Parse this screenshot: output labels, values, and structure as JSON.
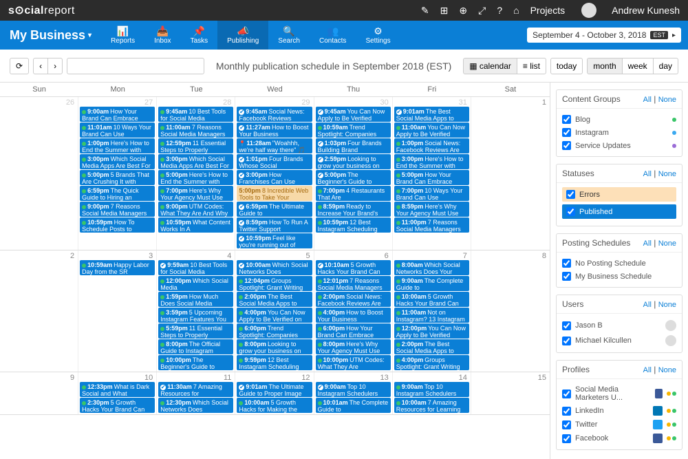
{
  "topbar": {
    "logo_prefix": "s",
    "logo_emoji_label": "cial",
    "logo_suffix": "report",
    "projects_label": "Projects",
    "username": "Andrew Kunesh"
  },
  "bluebar": {
    "business_name": "My Business",
    "nav": [
      {
        "icon": "📊",
        "label": "Reports"
      },
      {
        "icon": "📥",
        "label": "Inbox"
      },
      {
        "icon": "📌",
        "label": "Tasks"
      },
      {
        "icon": "📣",
        "label": "Publishing",
        "active": true
      },
      {
        "icon": "🔍",
        "label": "Search"
      },
      {
        "icon": "👥",
        "label": "Contacts"
      },
      {
        "icon": "⚙",
        "label": "Settings"
      }
    ],
    "date_range": "September 4 - October 3, 2018",
    "tz": "EST"
  },
  "toolbar": {
    "title": "Monthly publication schedule in September 2018 (EST)",
    "view_calendar": "calendar",
    "view_list": "list",
    "today": "today",
    "month": "month",
    "week": "week",
    "day": "day"
  },
  "dow": [
    "Sun",
    "Mon",
    "Tue",
    "Wed",
    "Thu",
    "Fri",
    "Sat"
  ],
  "weeks": [
    {
      "days": [
        {
          "num": "26",
          "other": true,
          "events": []
        },
        {
          "num": "27",
          "other": true,
          "events": [
            {
              "icon": "dot",
              "time": "9:00am",
              "title": "How Your Brand Can Embrace"
            },
            {
              "icon": "dot",
              "time": "11:01am",
              "title": "10 Ways Your Brand Can Use"
            },
            {
              "icon": "dot",
              "time": "1:00pm",
              "title": "Here's How to End the Summer with"
            },
            {
              "icon": "dot",
              "time": "3:00pm",
              "title": "Which Social Media Apps Are Best For"
            },
            {
              "icon": "dot",
              "time": "5:00pm",
              "title": "5 Brands That Are Crushing It with"
            },
            {
              "icon": "dot",
              "time": "6:59pm",
              "title": "The Quick Guide to Hiring an"
            },
            {
              "icon": "dot",
              "time": "9:00pm",
              "title": "7 Reasons Social Media Managers"
            },
            {
              "icon": "dot",
              "time": "10:59pm",
              "title": "How To Schedule Posts to"
            }
          ]
        },
        {
          "num": "28",
          "other": true,
          "events": [
            {
              "icon": "dot",
              "time": "9:45am",
              "title": "10 Best Tools for Social Media"
            },
            {
              "icon": "dot",
              "time": "11:00am",
              "title": "7 Reasons Social Media Managers"
            },
            {
              "icon": "dot",
              "time": "12:59pm",
              "title": "11 Essential Steps to Properly"
            },
            {
              "icon": "dot",
              "time": "3:00pm",
              "title": "Which Social Media Apps Are Best For"
            },
            {
              "icon": "dot",
              "time": "5:00pm",
              "title": "Here's How to End the Summer with"
            },
            {
              "icon": "dot",
              "time": "7:00pm",
              "title": "Here's Why Your Agency Must Use"
            },
            {
              "icon": "dot",
              "time": "9:00pm",
              "title": "UTM Codes: What They Are And Why"
            },
            {
              "icon": "dot",
              "time": "10:59pm",
              "title": "What Content Works In A"
            }
          ]
        },
        {
          "num": "29",
          "other": true,
          "events": [
            {
              "icon": "check",
              "time": "9:45am",
              "title": "Social News: Facebook Reviews"
            },
            {
              "icon": "check",
              "time": "11:27am",
              "title": "How to Boost Your Business"
            },
            {
              "icon": "loc",
              "time": "11:28am",
              "title": "\"Woahhh, we're half way there\" 🎵"
            },
            {
              "icon": "check",
              "time": "1:01pm",
              "title": "Four Brands Whose Social"
            },
            {
              "icon": "check",
              "time": "3:00pm",
              "title": "How Franchises Can Use"
            },
            {
              "icon": "",
              "time": "5:00pm",
              "title": "8 Incredible Web Tools to Take Your",
              "cls": "orange"
            },
            {
              "icon": "check",
              "time": "6:59pm",
              "title": "The Ultimate Guide to"
            },
            {
              "icon": "check",
              "time": "8:59pm",
              "title": "How To Run A Twitter Support"
            },
            {
              "icon": "check",
              "time": "10:59pm",
              "title": "Feel like you're running out of"
            }
          ]
        },
        {
          "num": "30",
          "other": true,
          "events": [
            {
              "icon": "check",
              "time": "9:45am",
              "title": "You Can Now Apply to Be Verified"
            },
            {
              "icon": "dot",
              "time": "10:59am",
              "title": "Trend Spotlight: Companies"
            },
            {
              "icon": "check",
              "time": "1:03pm",
              "title": "Four Brands Building Brand"
            },
            {
              "icon": "check",
              "time": "2:59pm",
              "title": "Looking to grow your business on"
            },
            {
              "icon": "check",
              "time": "5:00pm",
              "title": "The Beginner's Guide to"
            },
            {
              "icon": "dot",
              "time": "7:00pm",
              "title": "4 Restaurants That Are"
            },
            {
              "icon": "dot",
              "time": "8:59pm",
              "title": "Ready to Increase Your Brand's"
            },
            {
              "icon": "dot",
              "time": "10:59pm",
              "title": "12 Best Instagram Scheduling"
            }
          ]
        },
        {
          "num": "31",
          "other": true,
          "events": [
            {
              "icon": "check",
              "time": "9:01am",
              "title": "The Best Social Media Apps to"
            },
            {
              "icon": "dot",
              "time": "11:00am",
              "title": "You Can Now Apply to Be Verified"
            },
            {
              "icon": "dot",
              "time": "1:00pm",
              "title": "Social News: Facebook Reviews Are"
            },
            {
              "icon": "dot",
              "time": "3:00pm",
              "title": "Here's How to End the Summer with"
            },
            {
              "icon": "dot",
              "time": "5:00pm",
              "title": "How Your Brand Can Embrace"
            },
            {
              "icon": "dot",
              "time": "7:00pm",
              "title": "10 Ways Your Brand Can Use"
            },
            {
              "icon": "dot",
              "time": "8:59pm",
              "title": "Here's Why Your Agency Must Use"
            },
            {
              "icon": "dot",
              "time": "11:00pm",
              "title": "7 Reasons Social Media Managers"
            }
          ]
        },
        {
          "num": "1",
          "events": []
        }
      ]
    },
    {
      "days": [
        {
          "num": "2",
          "events": []
        },
        {
          "num": "3",
          "events": [
            {
              "icon": "dot",
              "time": "10:59am",
              "title": "Happy Labor Day from the SR"
            }
          ]
        },
        {
          "num": "4",
          "events": [
            {
              "icon": "check",
              "time": "9:59am",
              "title": "10 Best Tools for Social Media"
            },
            {
              "icon": "dot",
              "time": "12:00pm",
              "title": "Which Social Media"
            },
            {
              "icon": "dot",
              "time": "1:59pm",
              "title": "How Much Does Social Media"
            },
            {
              "icon": "dot",
              "time": "3:59pm",
              "title": "5 Upcoming Instagram Features You"
            },
            {
              "icon": "dot",
              "time": "5:59pm",
              "title": "11 Essential Steps to Properly"
            },
            {
              "icon": "dot",
              "time": "8:00pm",
              "title": "The Official Guide to Instagram"
            },
            {
              "icon": "dot",
              "time": "10:00pm",
              "title": "The Beginner's Guide to"
            }
          ]
        },
        {
          "num": "5",
          "events": [
            {
              "icon": "check",
              "time": "10:00am",
              "title": "Which Social Networks Does"
            },
            {
              "icon": "dot",
              "time": "12:04pm",
              "title": "Groups Spotlight: Grant Writing"
            },
            {
              "icon": "dot",
              "time": "2:00pm",
              "title": "The Best Social Media Apps to"
            },
            {
              "icon": "dot",
              "time": "4:00pm",
              "title": "You Can Now Apply to Be Verified on"
            },
            {
              "icon": "dot",
              "time": "6:00pm",
              "title": "Trend Spotlight: Companies"
            },
            {
              "icon": "dot",
              "time": "8:00pm",
              "title": "Looking to grow your business on"
            },
            {
              "icon": "dot",
              "time": "9:59pm",
              "title": "12 Best Instagram Scheduling"
            }
          ]
        },
        {
          "num": "6",
          "events": [
            {
              "icon": "check",
              "time": "10:10am",
              "title": "5 Growth Hacks Your Brand Can"
            },
            {
              "icon": "dot",
              "time": "12:01pm",
              "title": "7 Reasons Social Media Managers"
            },
            {
              "icon": "dot",
              "time": "2:00pm",
              "title": "Social News: Facebook Reviews Are"
            },
            {
              "icon": "dot",
              "time": "4:00pm",
              "title": "How to Boost Your Business"
            },
            {
              "icon": "dot",
              "time": "6:00pm",
              "title": "How Your Brand Can Embrace"
            },
            {
              "icon": "dot",
              "time": "8:00pm",
              "title": "Here's Why Your Agency Must Use"
            },
            {
              "icon": "dot",
              "time": "10:00pm",
              "title": "UTM Codes: What They Are"
            }
          ]
        },
        {
          "num": "7",
          "events": [
            {
              "icon": "dot",
              "time": "8:00am",
              "title": "Which Social Networks Does Your"
            },
            {
              "icon": "dot",
              "time": "9:00am",
              "title": "The Complete Guide to"
            },
            {
              "icon": "dot",
              "time": "10:00am",
              "title": "5 Growth Hacks Your Brand Can"
            },
            {
              "icon": "dot",
              "time": "11:00am",
              "title": "Not on Instagram? 13 Instagram"
            },
            {
              "icon": "dot",
              "time": "12:00pm",
              "title": "You Can Now Apply to Be Verified"
            },
            {
              "icon": "dot",
              "time": "2:00pm",
              "title": "The Best Social Media Apps to"
            },
            {
              "icon": "dot",
              "time": "4:00pm",
              "title": "Groups Spotlight: Grant Writing"
            }
          ]
        },
        {
          "num": "8",
          "events": []
        }
      ]
    },
    {
      "days": [
        {
          "num": "9",
          "events": []
        },
        {
          "num": "10",
          "events": [
            {
              "icon": "dot",
              "time": "12:33pm",
              "title": "What is Dark Social and What"
            },
            {
              "icon": "dot",
              "time": "2:30pm",
              "title": "5 Growth Hacks Your Brand Can"
            }
          ]
        },
        {
          "num": "11",
          "events": [
            {
              "icon": "check",
              "time": "11:30am",
              "title": "7 Amazing Resources for"
            },
            {
              "icon": "dot",
              "time": "12:30pm",
              "title": "Which Social Networks Does"
            }
          ]
        },
        {
          "num": "12",
          "events": [
            {
              "icon": "check",
              "time": "9:01am",
              "title": "The Ultimate Guide to Proper Image"
            },
            {
              "icon": "dot",
              "time": "10:00am",
              "title": "5 Growth Hacks for Making the"
            }
          ]
        },
        {
          "num": "13",
          "events": [
            {
              "icon": "check",
              "time": "9:00am",
              "title": "Top 10 Instagram Schedulers"
            },
            {
              "icon": "dot",
              "time": "10:01am",
              "title": "The Complete Guide to"
            }
          ]
        },
        {
          "num": "14",
          "events": [
            {
              "icon": "dot",
              "time": "9:00am",
              "title": "Top 10 Instagram Schedulers"
            },
            {
              "icon": "dot",
              "time": "10:00am",
              "title": "7 Amazing Resources for Learning"
            }
          ]
        },
        {
          "num": "15",
          "events": []
        }
      ]
    }
  ],
  "sidebar": {
    "all": "All",
    "none": "None",
    "content_groups": {
      "title": "Content Groups",
      "items": [
        {
          "label": "Blog",
          "color": "#3ac569"
        },
        {
          "label": "Instagram",
          "color": "#3ba9f0"
        },
        {
          "label": "Service Updates",
          "color": "#9b6dd7"
        }
      ]
    },
    "statuses": {
      "title": "Statuses",
      "errors": "Errors",
      "published": "Published"
    },
    "posting": {
      "title": "Posting Schedules",
      "items": [
        "No Posting Schedule",
        "My Business Schedule"
      ]
    },
    "users": {
      "title": "Users",
      "items": [
        "Jason B",
        "Michael Kilcullen"
      ]
    },
    "profiles": {
      "title": "Profiles",
      "items": [
        {
          "label": "Social Media Marketers U...",
          "cls": "pi-fb"
        },
        {
          "label": "LinkedIn",
          "cls": "pi-in"
        },
        {
          "label": "Twitter",
          "cls": "pi-tw"
        },
        {
          "label": "Facebook",
          "cls": "pi-fb"
        }
      ]
    }
  }
}
